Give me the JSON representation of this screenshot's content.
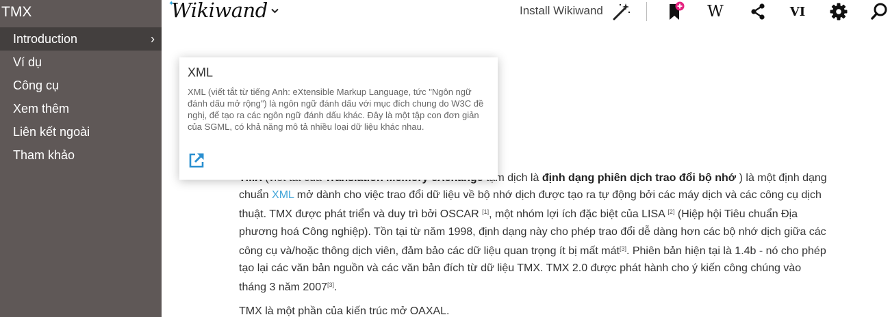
{
  "sidebar": {
    "title": "TMX",
    "items": [
      {
        "label": "Introduction"
      },
      {
        "label": "Ví dụ"
      },
      {
        "label": "Công cụ"
      },
      {
        "label": "Xem thêm"
      },
      {
        "label": "Liên kết ngoài"
      },
      {
        "label": "Tham khảo"
      }
    ],
    "active_chevron": "›"
  },
  "header": {
    "logo": "Wikiwand",
    "install_label": "Install Wikiwand",
    "wikipedia_label": "W",
    "language_label": "VI",
    "icons": [
      "chevron-down-icon",
      "magic-wand-icon",
      "bookmark-plus-icon",
      "wikipedia-icon",
      "share-icon",
      "language-icon",
      "gear-icon",
      "search-icon"
    ]
  },
  "popup": {
    "title": "XML",
    "body": "XML (viết tắt từ tiếng Anh: eXtensible Markup Language, tức \"Ngôn ngữ đánh dấu mở rộng\") là ngôn ngữ đánh dấu với mục đích chung do W3C đề nghị, để tạo ra các ngôn ngữ đánh dấu khác. Đây là một tập con đơn giản của SGML, có khả năng mô tả nhiều loại dữ liệu khác nhau."
  },
  "article": {
    "p1": {
      "lead_bold": "TMX",
      "t1": " (viết tắt của ",
      "bold2": "Translation Memory eXchange",
      "t2": " tạm dịch là ",
      "bold3": "định dạng phiên dịch trao đổi bộ nhớ",
      "t3": " ) là một định dạng chuẩn ",
      "link_xml": "XML",
      "t4": " mở dành cho việc trao đổi dữ liệu về bộ nhớ dịch được tạo ra tự động bởi các máy dịch và các công cụ dịch thuật. TMX được phát triển và duy trì bởi OSCAR ",
      "ref1": "[1]",
      "t5": ", một nhóm lợi ích đặc biệt của LISA ",
      "ref2": "[2]",
      "t6": " (Hiệp hội Tiêu chuẩn Địa phương hoá Công nghiệp). Tồn tại từ năm 1998, định dạng này cho phép trao đổi dễ dàng hơn các bộ nhớ dịch giữa các công cụ và/hoặc thông dịch viên, đảm bảo các dữ liệu quan trọng ít bị mất mát",
      "ref3": "[3]",
      "t7": ". Phiên bản hiện tại là 1.4b - nó cho phép tạo lại các văn bản nguồn và các văn bản đích từ dữ liệu TMX. TMX 2.0 được phát hành cho ý kiến công chúng vào tháng 3 năm 2007",
      "ref4": "[3]",
      "t8": "."
    },
    "p2": "TMX là một phần của kiến trúc mở OAXAL."
  },
  "colors": {
    "sidebar_bg": "#5f5857",
    "sidebar_active": "#433f3e",
    "link": "#3ea3d8",
    "badge": "#e4227f"
  }
}
